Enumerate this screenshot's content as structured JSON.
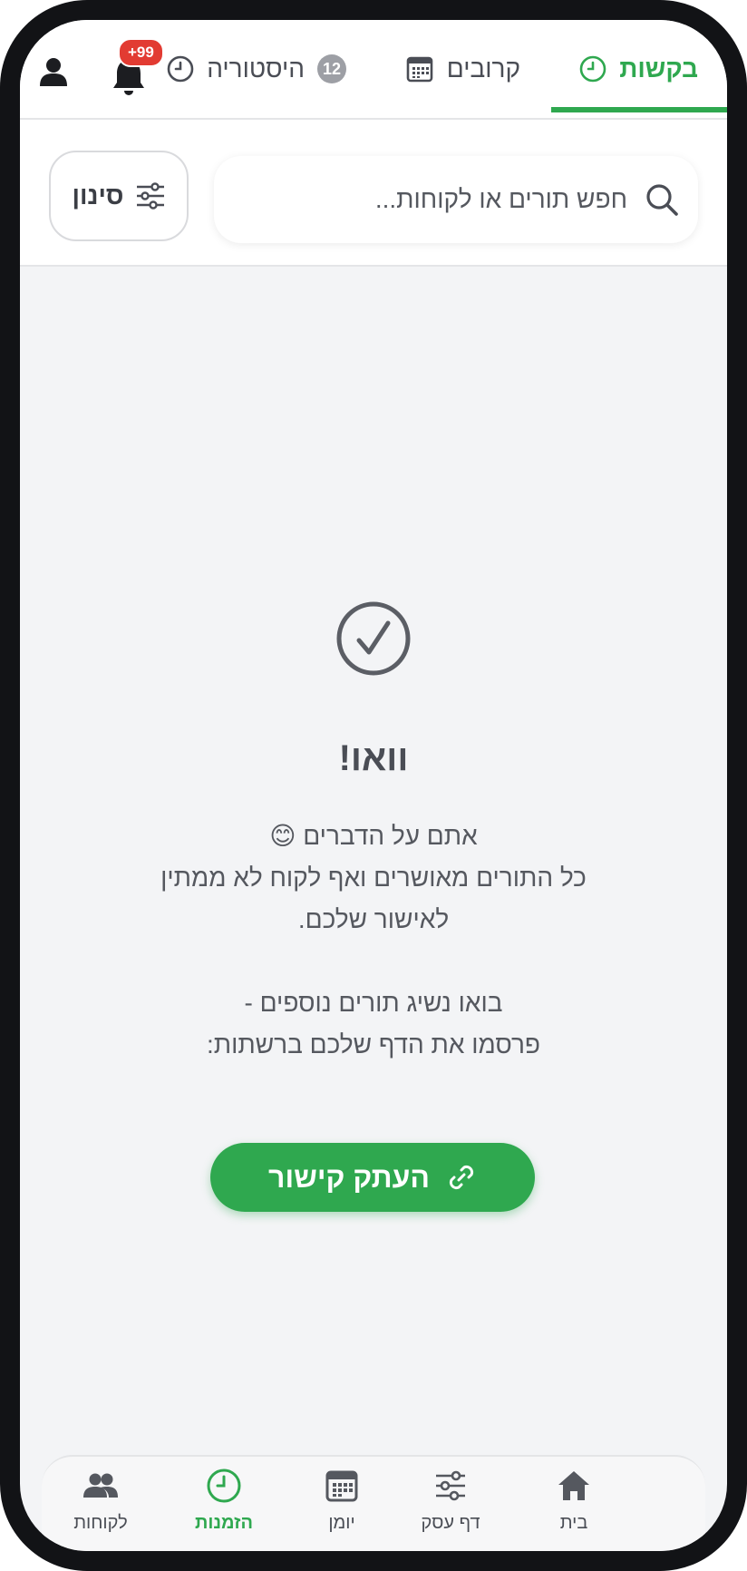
{
  "tabs": [
    {
      "label": "בקשות",
      "icon": "clock-icon",
      "active": true
    },
    {
      "label": "קרובים",
      "icon": "calendar-icon",
      "active": false
    },
    {
      "label": "היסטוריה",
      "icon": "clock-icon",
      "count": "12",
      "active": false
    }
  ],
  "header": {
    "notifications_badge": "+99",
    "bell_icon": "bell-icon",
    "profile_icon": "user-icon"
  },
  "search": {
    "placeholder": "חפש תורים או לקוחות...",
    "value": ""
  },
  "filter": {
    "label": "סינון"
  },
  "empty_state": {
    "title": "וואו!",
    "line1": "אתם על הדברים 😊",
    "line2": "כל התורים מאושרים ואף לקוח לא ממתין",
    "line3": "לאישור שלכם.",
    "line4": "בואו נשיג תורים נוספים -",
    "line5": "פרסמו את הדף שלכם ברשתות:"
  },
  "copy_link": {
    "label": "העתק קישור"
  },
  "bottom_nav": [
    {
      "label": "בית",
      "icon": "home-icon"
    },
    {
      "label": "דף עסק",
      "icon": "sliders-icon"
    },
    {
      "label": "יומן",
      "icon": "calendar-icon"
    },
    {
      "label": "הזמנות",
      "icon": "clock-icon",
      "active": true
    },
    {
      "label": "לקוחות",
      "icon": "users-icon"
    }
  ],
  "colors": {
    "accent": "#2fa84f",
    "badge": "#e23b32",
    "text": "#4a4d55",
    "background": "#f3f4f6"
  }
}
